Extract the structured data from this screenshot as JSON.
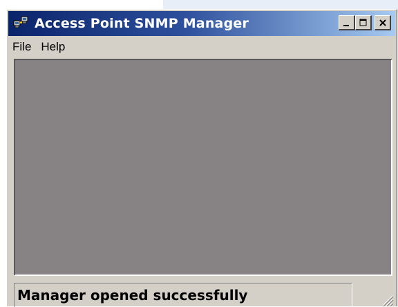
{
  "window": {
    "title": "Access Point SNMP Manager",
    "app_icon": "network-computers-icon",
    "controls": {
      "minimize_glyph": "_",
      "maximize_glyph": "□",
      "close_glyph": "✕"
    }
  },
  "menu": {
    "items": [
      {
        "label": "File"
      },
      {
        "label": "Help"
      }
    ]
  },
  "status_bar": {
    "message": "Manager opened successfully"
  },
  "colors": {
    "title_start": "#0a246a",
    "title_end": "#a6caf0",
    "client_area": "#878384",
    "window_face": "#d4d0c8"
  }
}
